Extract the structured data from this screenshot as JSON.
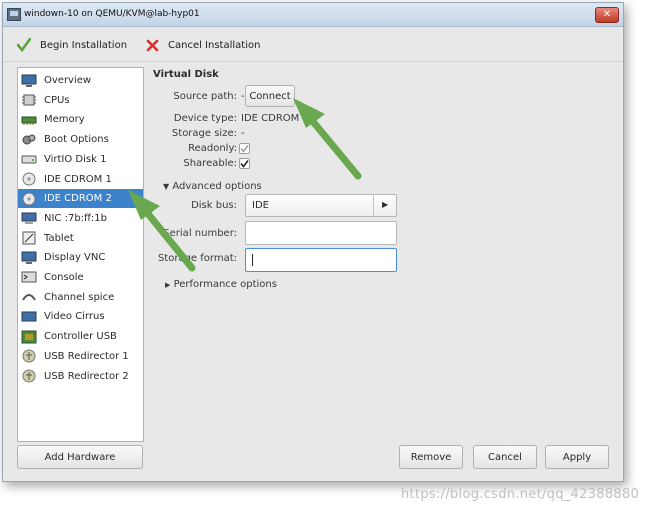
{
  "window": {
    "title": "windown-10 on QEMU/KVM@lab-hyp01"
  },
  "toolbar": {
    "begin_label": "Begin Installation",
    "cancel_label": "Cancel Installation"
  },
  "sidebar": {
    "items": [
      {
        "label": "Overview",
        "icon": "overview-icon"
      },
      {
        "label": "CPUs",
        "icon": "cpu-icon"
      },
      {
        "label": "Memory",
        "icon": "memory-icon"
      },
      {
        "label": "Boot Options",
        "icon": "boot-options-icon"
      },
      {
        "label": "VirtIO Disk 1",
        "icon": "disk-icon"
      },
      {
        "label": "IDE CDROM 1",
        "icon": "cdrom-icon"
      },
      {
        "label": "IDE CDROM 2",
        "icon": "cdrom-icon",
        "selected": true
      },
      {
        "label": "NIC :7b:ff:1b",
        "icon": "nic-icon"
      },
      {
        "label": "Tablet",
        "icon": "tablet-icon"
      },
      {
        "label": "Display VNC",
        "icon": "display-icon"
      },
      {
        "label": "Console",
        "icon": "console-icon"
      },
      {
        "label": "Channel spice",
        "icon": "channel-icon"
      },
      {
        "label": "Video Cirrus",
        "icon": "video-icon"
      },
      {
        "label": "Controller USB",
        "icon": "controller-icon"
      },
      {
        "label": "USB Redirector 1",
        "icon": "usb-icon"
      },
      {
        "label": "USB Redirector 2",
        "icon": "usb-icon"
      }
    ],
    "add_hardware_label": "Add Hardware"
  },
  "disk": {
    "section_title": "Virtual Disk",
    "source_path_label": "Source path:",
    "source_path_value": "-",
    "connect_label": "Connect",
    "device_type_label": "Device type:",
    "device_type_value": "IDE CDROM 2",
    "storage_size_label": "Storage size:",
    "storage_size_value": "-",
    "readonly_label": "Readonly:",
    "readonly_checked": true,
    "shareable_label": "Shareable:",
    "shareable_checked": true
  },
  "advanced": {
    "title": "Advanced options",
    "disk_bus_label": "Disk bus:",
    "disk_bus_value": "IDE",
    "serial_label": "Serial number:",
    "serial_value": "",
    "storage_format_label": "Storage format:",
    "storage_format_value": ""
  },
  "performance": {
    "title": "Performance options"
  },
  "buttons": {
    "remove": "Remove",
    "cancel": "Cancel",
    "apply": "Apply"
  },
  "watermark": "https://blog.csdn.net/qq_42388880",
  "colors": {
    "selection": "#3d83cc",
    "arrow": "#6aa84f",
    "close": "#c23b26"
  }
}
